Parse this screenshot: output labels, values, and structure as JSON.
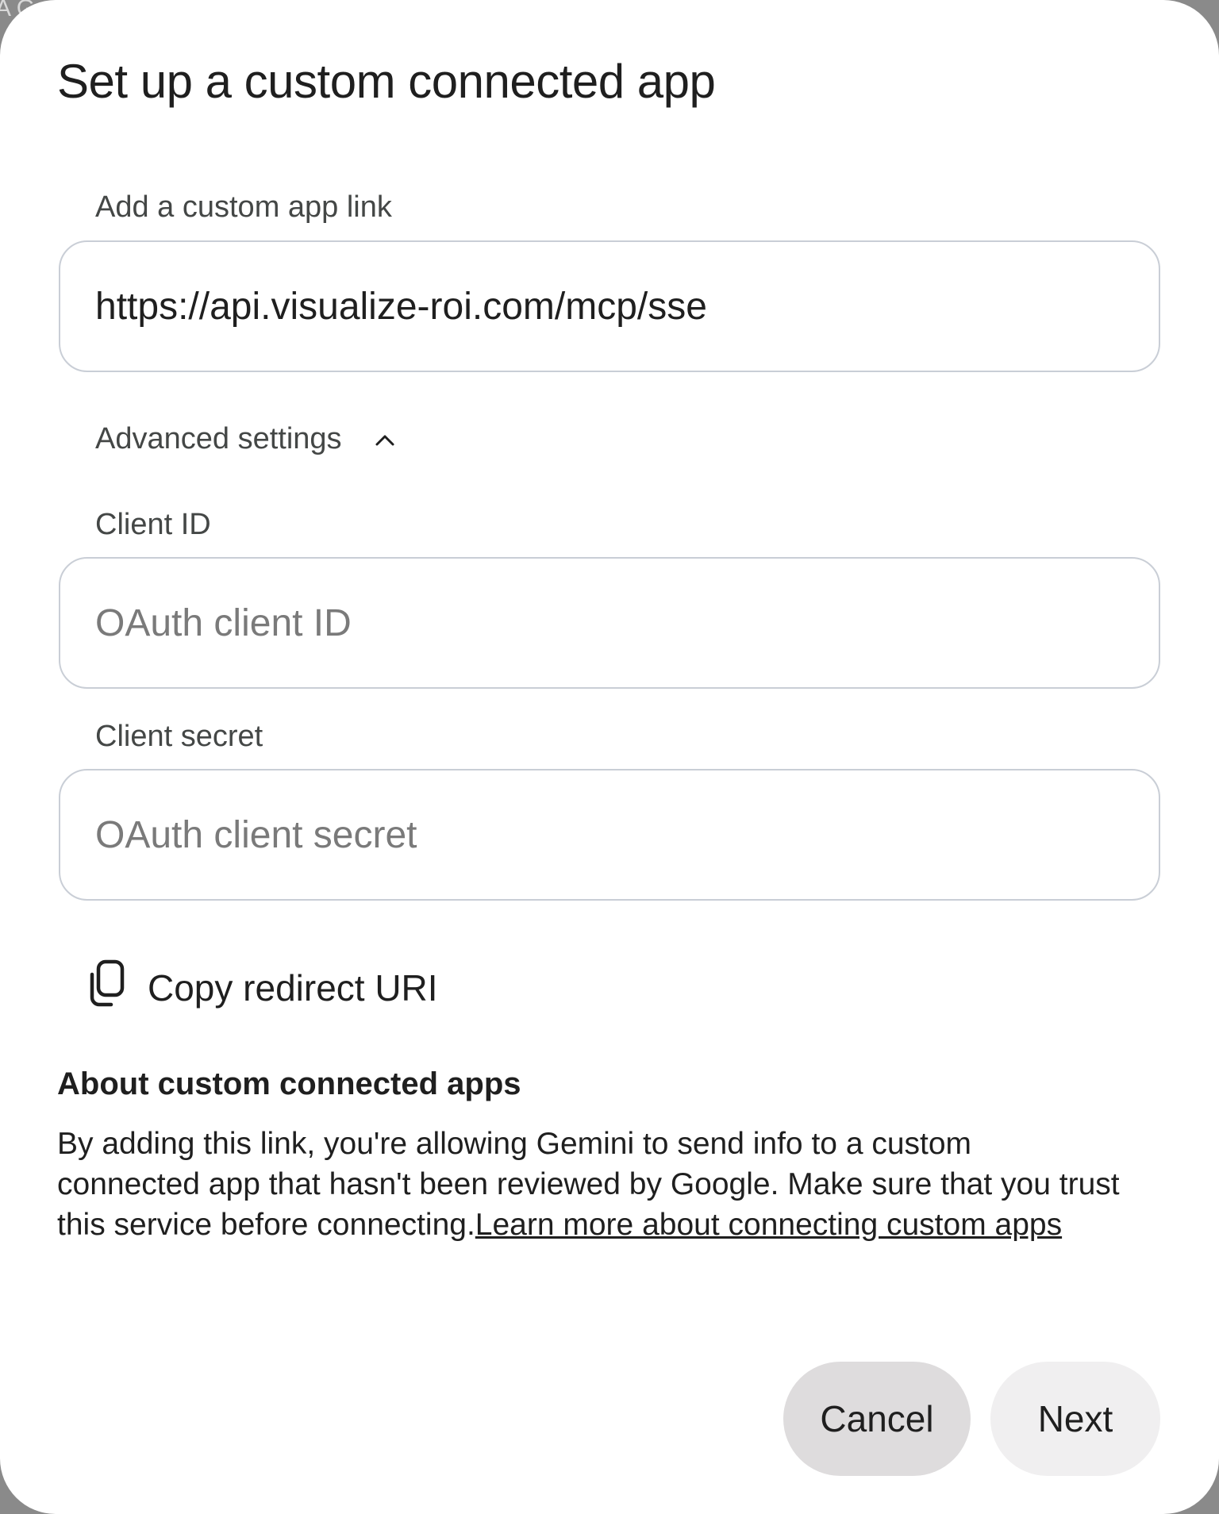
{
  "backdrop": {
    "text": "A G"
  },
  "dialog": {
    "title": "Set up a custom connected app",
    "app_link": {
      "label": "Add a custom app link",
      "value": "https://api.visualize-roi.com/mcp/sse"
    },
    "advanced": {
      "label": "Advanced settings",
      "expanded": true,
      "icon": "chevron-up-icon"
    },
    "client_id": {
      "label": "Client ID",
      "placeholder": "OAuth client ID"
    },
    "client_secret": {
      "label": "Client secret",
      "placeholder": "OAuth client secret"
    },
    "copy_redirect": {
      "label": "Copy redirect URI",
      "icon": "copy-icon"
    },
    "about": {
      "title": "About custom connected apps",
      "body": "By adding this link, you're allowing Gemini to send info to a custom connected app that hasn't been reviewed by Google. Make sure that you trust this service before connecting.",
      "link_text": "Learn more about connecting custom apps"
    },
    "buttons": {
      "cancel": "Cancel",
      "next": "Next"
    }
  }
}
